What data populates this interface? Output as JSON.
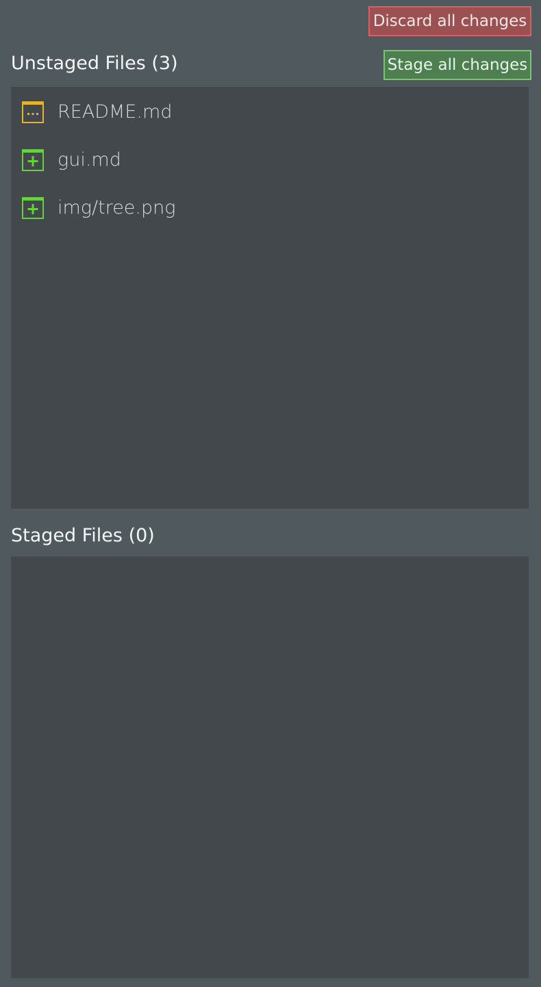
{
  "toolbar": {
    "discard_label": "Discard all changes",
    "stage_label": "Stage all changes"
  },
  "unstaged": {
    "title": "Unstaged Files (3)",
    "files": [
      {
        "name": "README.md",
        "status": "modified",
        "icon": "file-modified-icon",
        "color": "#e3b42b"
      },
      {
        "name": "gui.md",
        "status": "added",
        "icon": "file-added-icon",
        "color": "#6bd03f"
      },
      {
        "name": "img/tree.png",
        "status": "added",
        "icon": "file-added-icon",
        "color": "#6bd03f"
      }
    ]
  },
  "staged": {
    "title": "Staged Files (0)",
    "files": []
  },
  "colors": {
    "background": "#505a5e",
    "panel": "#43484c",
    "discard": "#9b5151",
    "stage": "#4e7f50",
    "modified": "#e3b42b",
    "added": "#6bd03f"
  }
}
